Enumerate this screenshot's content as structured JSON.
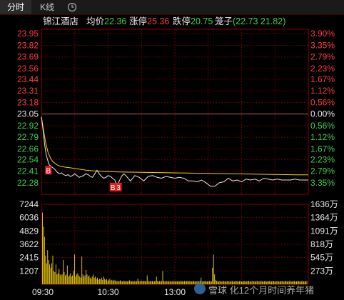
{
  "tabs": [
    {
      "label": "分时",
      "active": true
    },
    {
      "label": "K线",
      "active": false
    },
    {
      "icon": "clock-icon"
    }
  ],
  "header": {
    "name": "锦江酒店",
    "avg_label": "均价",
    "avg_value": "22.36",
    "limitup_label": "涨停",
    "limitup_value": "25.36",
    "limitdown_label": "跌停",
    "limitdown_value": "20.75",
    "cage_label": "笼子",
    "cage_value": "(22.73 21.82)"
  },
  "colors": {
    "up": "#ff3d3d",
    "down": "#3fd14a",
    "price_line": "#e8e8e8",
    "avg_line": "#f2d200",
    "volume": "#f2d200",
    "grid": "#6a0000",
    "border": "#8b0000",
    "flat": "#e8e8e8"
  },
  "chart_data": {
    "type": "line",
    "prev_close": 23.05,
    "ylim": [
      22.15,
      24.0
    ],
    "price_ticks": [
      "23.95",
      "23.82",
      "23.69",
      "23.56",
      "23.44",
      "23.31",
      "23.18",
      "23.05",
      "22.92",
      "22.79",
      "22.66",
      "22.54",
      "22.41",
      "22.28"
    ],
    "pct_ticks": [
      "3.90%",
      "3.35%",
      "2.79%",
      "2.23%",
      "1.67%",
      "1.12%",
      "0.56%",
      "0.00%",
      "0.56%",
      "1.12%",
      "1.67%",
      "2.23%",
      "2.79%",
      "3.35%"
    ],
    "x_labels": [
      "09:30",
      "10:30",
      "13:00"
    ],
    "x_minutes": [
      0,
      60,
      120
    ],
    "x_total": 240,
    "series": [
      {
        "x": [
          0,
          1,
          2,
          3,
          4,
          5,
          6,
          7,
          8,
          10,
          12,
          14,
          16,
          18,
          20,
          22,
          24,
          26,
          28,
          30,
          32,
          34,
          36,
          38,
          40,
          42,
          44,
          46,
          48,
          50,
          52,
          54,
          56,
          58,
          60,
          62,
          64,
          66,
          68,
          70,
          72,
          74,
          76,
          80,
          84,
          88,
          92,
          96,
          100,
          104,
          108,
          112,
          116,
          120,
          124,
          128,
          132,
          136,
          140,
          144,
          148,
          152,
          156,
          160,
          164,
          168,
          172,
          176,
          180,
          184,
          188,
          192,
          196,
          200,
          204,
          208,
          212,
          216,
          220,
          224,
          228,
          232,
          236,
          240
        ],
        "values": [
          23.02,
          22.92,
          22.82,
          22.7,
          22.62,
          22.56,
          22.52,
          22.48,
          22.47,
          22.45,
          22.43,
          22.4,
          22.38,
          22.39,
          22.37,
          22.36,
          22.37,
          22.35,
          22.36,
          22.38,
          22.36,
          22.34,
          22.35,
          22.36,
          22.38,
          22.37,
          22.35,
          22.34,
          22.38,
          22.42,
          22.38,
          22.35,
          22.33,
          22.34,
          22.36,
          22.35,
          22.33,
          22.31,
          22.24,
          22.3,
          22.35,
          22.38,
          22.36,
          22.3,
          22.36,
          22.34,
          22.3,
          22.35,
          22.36,
          22.34,
          22.33,
          22.35,
          22.34,
          22.33,
          22.34,
          22.33,
          22.3,
          22.3,
          22.29,
          22.31,
          22.28,
          22.24,
          22.24,
          22.28,
          22.29,
          22.33,
          22.3,
          22.31,
          22.29,
          22.32,
          22.31,
          22.32,
          22.3,
          22.33,
          22.32,
          22.31,
          22.32,
          22.31,
          22.31,
          22.31,
          22.32,
          22.31,
          22.31,
          22.31
        ]
      },
      {
        "x": [
          0,
          2,
          4,
          6,
          8,
          10,
          14,
          18,
          24,
          30,
          40,
          50,
          60,
          70,
          80,
          90,
          100,
          110,
          120,
          130,
          140,
          150,
          160,
          170,
          180,
          190,
          200,
          210,
          220,
          230,
          240
        ],
        "values": [
          23.02,
          22.86,
          22.72,
          22.62,
          22.56,
          22.52,
          22.48,
          22.46,
          22.45,
          22.44,
          22.42,
          22.41,
          22.405,
          22.4,
          22.398,
          22.396,
          22.394,
          22.392,
          22.39,
          22.388,
          22.386,
          22.384,
          22.382,
          22.38,
          22.378,
          22.376,
          22.374,
          22.372,
          22.37,
          22.369,
          22.368
        ]
      }
    ],
    "markers": [
      {
        "x": 6,
        "y": 22.42,
        "text": "B"
      },
      {
        "x": 64,
        "y": 22.23,
        "text": "B"
      },
      {
        "x": 69,
        "y": 22.23,
        "text": "3"
      }
    ],
    "volume": {
      "ticks": [
        "7244",
        "6036",
        "4829",
        "3622",
        "2415",
        "1207"
      ],
      "right_ticks": [
        "1636万",
        "1364万",
        "1091万",
        "818万",
        "545万",
        "273万"
      ],
      "ylim": [
        0,
        7244
      ],
      "values": [
        6500,
        5200,
        4300,
        2600,
        1900,
        3100,
        2200,
        1800,
        1500,
        1900,
        2600,
        1200,
        1100,
        1800,
        900,
        1000,
        1400,
        900,
        800,
        900,
        2200,
        1100,
        800,
        900,
        1700,
        700,
        800,
        1000,
        700,
        800,
        1200,
        2700,
        700,
        900,
        1000,
        800,
        700,
        600,
        2500,
        900,
        700,
        800,
        1300,
        900,
        700,
        800,
        600,
        500,
        700,
        900,
        600,
        700,
        500,
        600,
        400,
        500,
        450,
        600,
        400,
        700,
        500,
        400,
        450,
        300,
        400,
        500,
        350,
        400,
        300,
        400,
        350,
        300,
        300,
        250,
        300,
        350,
        300,
        250,
        300,
        300,
        250,
        300,
        250,
        300,
        350,
        300,
        250,
        300,
        250,
        300,
        250,
        300,
        500,
        300,
        250,
        350,
        300,
        280,
        320,
        300,
        250,
        800,
        300,
        250,
        300,
        260,
        300,
        250,
        280,
        300,
        700,
        300,
        250,
        300,
        250,
        300,
        1200,
        300,
        250,
        280,
        300,
        250,
        300,
        250,
        260,
        280,
        250,
        300,
        250,
        280,
        260,
        300,
        250,
        280,
        300,
        250,
        260,
        300,
        250,
        280,
        300,
        250,
        300,
        260,
        250,
        280,
        300,
        250,
        260,
        300,
        250,
        280,
        300,
        600,
        250,
        260,
        280,
        300,
        250,
        260,
        280,
        300,
        250,
        260,
        1500,
        2700,
        900,
        400,
        300,
        280,
        250,
        300,
        260,
        250,
        280,
        300,
        250,
        260,
        280,
        300,
        250,
        260,
        280,
        300,
        250,
        260,
        280,
        300,
        250,
        260,
        280,
        300,
        250,
        260,
        280,
        300,
        250,
        260,
        280,
        300,
        250,
        260,
        280,
        300,
        250,
        260,
        280,
        300,
        250,
        260,
        280,
        300,
        250,
        260,
        280,
        300,
        250,
        260,
        280,
        300,
        250,
        260,
        280,
        300,
        250,
        260,
        280,
        300,
        250,
        260,
        280,
        300,
        250,
        260,
        280,
        300,
        250,
        260,
        280,
        300,
        250,
        260,
        280,
        300,
        250,
        260,
        280,
        300,
        250,
        260,
        280,
        300,
        250,
        260,
        280,
        300
      ]
    }
  },
  "watermark": {
    "text": "雪球 化12个月时间养年猪"
  }
}
